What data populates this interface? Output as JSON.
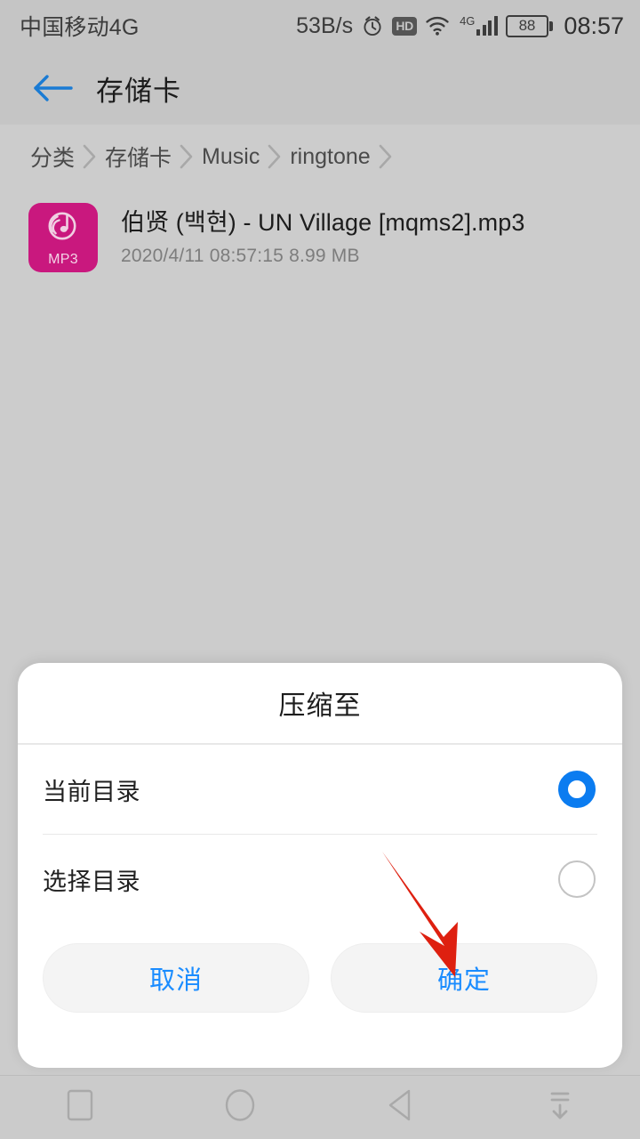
{
  "statusbar": {
    "carrier": "中国移动4G",
    "net_speed": "53B/s",
    "icons": [
      "alarm-icon",
      "hd-icon",
      "wifi-icon",
      "4g-signal-icon",
      "battery-icon"
    ],
    "signal_label": "4G",
    "battery_level": "88",
    "clock": "08:57"
  },
  "titlebar": {
    "back_icon": "back-arrow-icon",
    "title": "存储卡",
    "accent": "#1a7bd4"
  },
  "breadcrumb": {
    "items": [
      "分类",
      "存储卡",
      "Music",
      "ringtone"
    ],
    "separator_icon": "chevron-right-icon"
  },
  "files": [
    {
      "icon_label": "MP3",
      "icon_color": "#c9187e",
      "name": "伯贤 (백현) - UN Village [mqms2].mp3",
      "meta": "2020/4/11 08:57:15 8.99 MB"
    }
  ],
  "dialog": {
    "title": "压缩至",
    "options": [
      {
        "label": "当前目录",
        "selected": true
      },
      {
        "label": "选择目录",
        "selected": false
      }
    ],
    "cancel_label": "取消",
    "confirm_label": "确定",
    "radio_on_color": "#0b7cf0",
    "radio_off_color": "#c3c3c3",
    "button_text_color": "#1a8cff"
  },
  "annotation": {
    "type": "red-arrow",
    "color": "#de2010",
    "points_to": "确定"
  },
  "navbar": {
    "buttons": [
      {
        "name": "recents-button",
        "icon": "square-icon"
      },
      {
        "name": "home-button",
        "icon": "circle-icon"
      },
      {
        "name": "back-button",
        "icon": "triangle-left-icon"
      },
      {
        "name": "hide-navbar-button",
        "icon": "collapse-down-icon"
      }
    ]
  },
  "colors": {
    "page_bg": "#cccccc",
    "bar_bg": "#c5c5c5",
    "dialog_bg": "#ffffff"
  }
}
